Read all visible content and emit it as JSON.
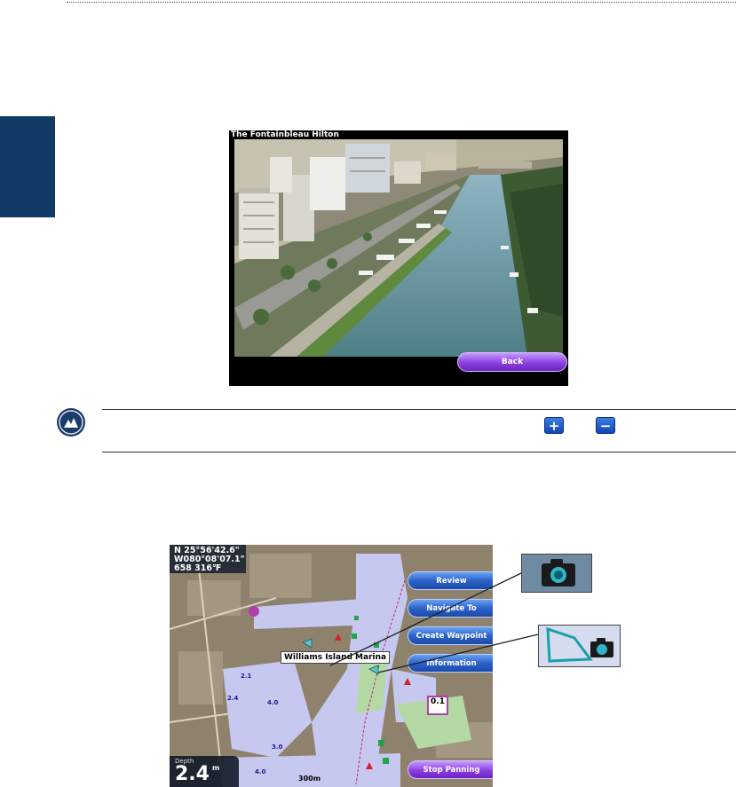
{
  "photo_viewer": {
    "title": "The Fontainbleau Hilton",
    "back_label": "Back"
  },
  "map_screen": {
    "coordinates": {
      "latitude": "N  25°56'42.6\"",
      "longitude": "W080°08'07.1\"",
      "extra": "658     316℉"
    },
    "buttons": [
      "Review",
      "Navigate To",
      "Create Waypoint",
      "Information"
    ],
    "stop_panning_label": "Stop Panning",
    "depth_label": "Depth",
    "depth_value": "2.4",
    "depth_unit": "m",
    "callout": "Williams Island Marina",
    "scale": "300m",
    "depth_indicator": "0.1"
  },
  "colors": {
    "side_tab": "#123a66",
    "map_button": "#2c62c9",
    "purple_button": "#8b3fe0",
    "water": "#c6c8f0"
  },
  "icons": [
    "note-icon",
    "plus-icon",
    "minus-icon",
    "camera-icon",
    "photo-area-camera-icon"
  ]
}
